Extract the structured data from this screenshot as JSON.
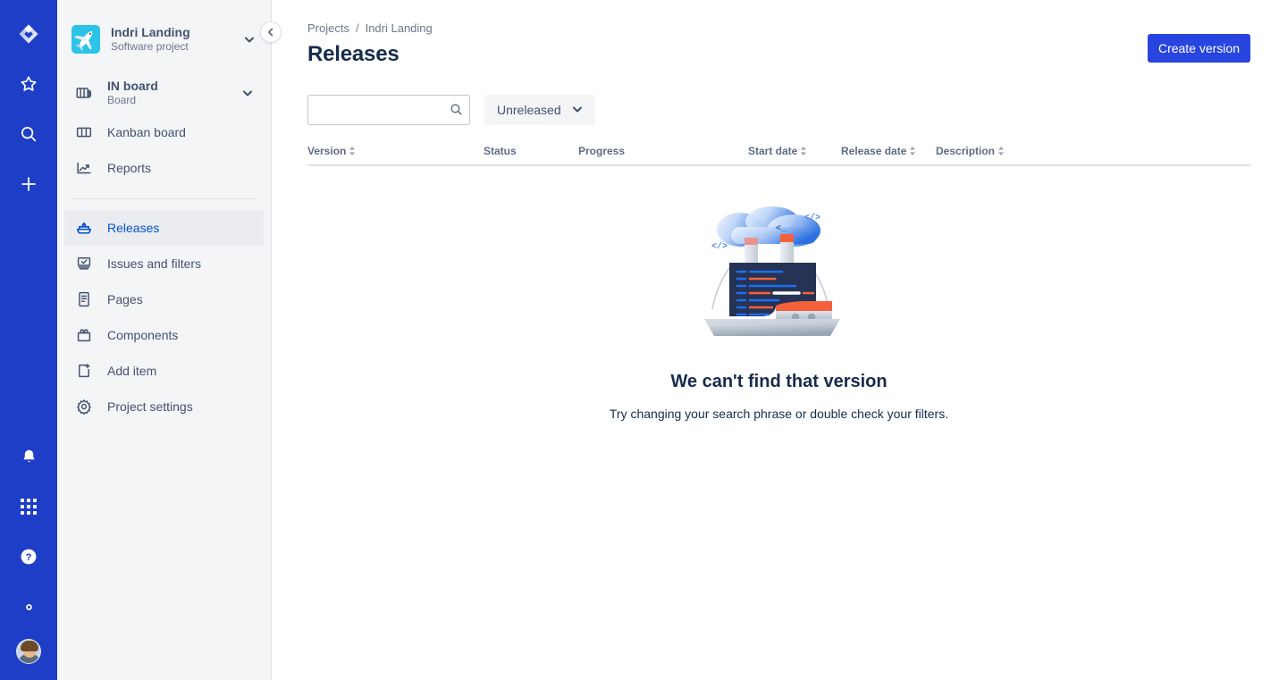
{
  "rail": {
    "top_items": [
      {
        "name": "jira-logo-icon",
        "label": "Jira"
      },
      {
        "name": "starred-icon",
        "label": "Starred"
      },
      {
        "name": "search-icon",
        "label": "Search"
      },
      {
        "name": "create-icon",
        "label": "Create"
      }
    ],
    "bottom_items": [
      {
        "name": "notifications-bell-icon",
        "label": "Notifications"
      },
      {
        "name": "app-switcher-icon",
        "label": "App switcher"
      },
      {
        "name": "help-icon",
        "label": "Help"
      },
      {
        "name": "settings-gear-icon",
        "label": "Settings"
      },
      {
        "name": "user-avatar",
        "label": "Your profile"
      }
    ]
  },
  "sidebar": {
    "project": {
      "name": "Indri Landing",
      "type": "Software project",
      "avatar_icon": "airplane-icon",
      "avatar_color": "#2bc4e8"
    },
    "board": {
      "title": "IN board",
      "subtitle": "Board"
    },
    "items": [
      {
        "label": "Kanban board",
        "icon": "board-columns-icon",
        "selected": false
      },
      {
        "label": "Reports",
        "icon": "reports-chart-icon",
        "selected": false
      },
      {
        "label": "Releases",
        "icon": "ship-icon",
        "selected": true
      },
      {
        "label": "Issues and filters",
        "icon": "issues-filters-icon",
        "selected": false
      },
      {
        "label": "Pages",
        "icon": "pages-document-icon",
        "selected": false
      },
      {
        "label": "Components",
        "icon": "components-icon",
        "selected": false
      },
      {
        "label": "Add item",
        "icon": "add-item-icon",
        "selected": false
      },
      {
        "label": "Project settings",
        "icon": "gear-icon",
        "selected": false
      }
    ],
    "collapse_label": "Collapse sidebar"
  },
  "breadcrumb": {
    "projects": "Projects",
    "separator": "/",
    "current": "Indri Landing"
  },
  "header": {
    "title": "Releases",
    "create_button": "Create version",
    "accent_color": "#2845e0"
  },
  "toolbar": {
    "search_value": "",
    "search_placeholder": "",
    "search_icon": "search-icon",
    "filter_value": "Unreleased",
    "filter_icon": "chevron-down-icon"
  },
  "table": {
    "columns": [
      {
        "label": "Version",
        "sortable": true
      },
      {
        "label": "Status",
        "sortable": false
      },
      {
        "label": "Progress",
        "sortable": false
      },
      {
        "label": "Start date",
        "sortable": true
      },
      {
        "label": "Release date",
        "sortable": true
      },
      {
        "label": "Description",
        "sortable": true
      }
    ],
    "rows": []
  },
  "empty_state": {
    "illustration": "ship-sailing-illustration",
    "title": "We can't find that version",
    "subtitle": "Try changing your search phrase or double check your filters."
  }
}
